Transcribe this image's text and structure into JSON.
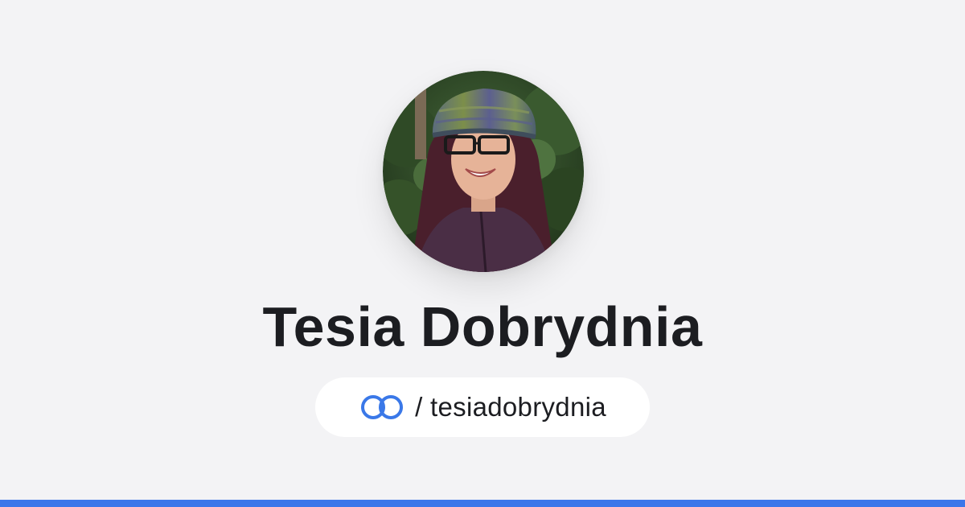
{
  "profile": {
    "name": "Tesia Dobrydnia",
    "separator": "/",
    "handle": "tesiadobrydnia",
    "avatar_icon": "profile-photo"
  },
  "brand": {
    "logo_icon": "linked-rings-icon",
    "accent_color": "#3a78e8",
    "bar_color": "#3b76ea",
    "background_color": "#f3f3f5"
  }
}
